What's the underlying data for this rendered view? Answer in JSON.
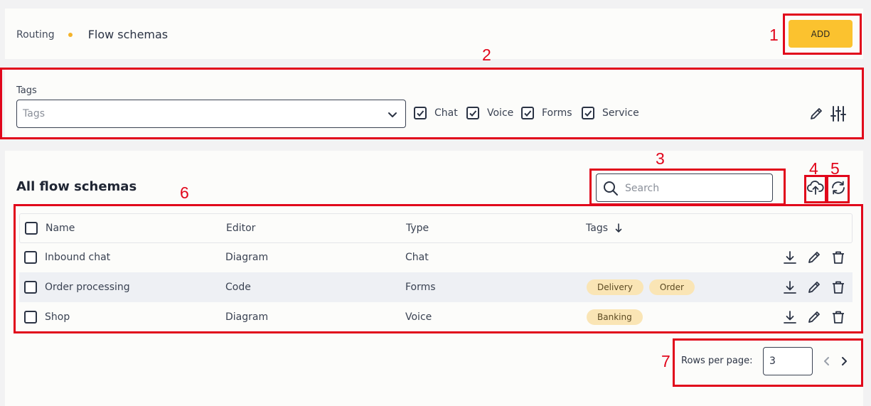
{
  "breadcrumb": {
    "parent": "Routing",
    "current": "Flow schemas"
  },
  "header": {
    "add_label": "ADD"
  },
  "filters": {
    "tags_label": "Tags",
    "tags_placeholder": "Tags",
    "types": [
      {
        "label": "Chat",
        "checked": true
      },
      {
        "label": "Voice",
        "checked": true
      },
      {
        "label": "Forms",
        "checked": true
      },
      {
        "label": "Service",
        "checked": true
      }
    ]
  },
  "main": {
    "title": "All flow schemas",
    "search_placeholder": "Search",
    "table": {
      "columns": [
        "Name",
        "Editor",
        "Type",
        "Tags"
      ],
      "sort_column": "Tags",
      "sort_direction": "descending",
      "rows": [
        {
          "name": "Inbound chat",
          "editor": "Diagram",
          "type": "Chat",
          "tags": []
        },
        {
          "name": "Order processing",
          "editor": "Code",
          "type": "Forms",
          "tags": [
            "Delivery",
            "Order"
          ]
        },
        {
          "name": "Shop",
          "editor": "Diagram",
          "type": "Voice",
          "tags": [
            "Banking"
          ]
        }
      ]
    }
  },
  "pagination": {
    "rows_per_page_label": "Rows per page:",
    "rows_per_page_value": "3"
  },
  "annotations": [
    "1",
    "2",
    "3",
    "4",
    "5",
    "6",
    "7"
  ],
  "colors": {
    "accent": "#fbc22f",
    "annotation": "#e1061b",
    "tag_bg": "#fae5b5",
    "row_alt": "#eef0f4"
  }
}
